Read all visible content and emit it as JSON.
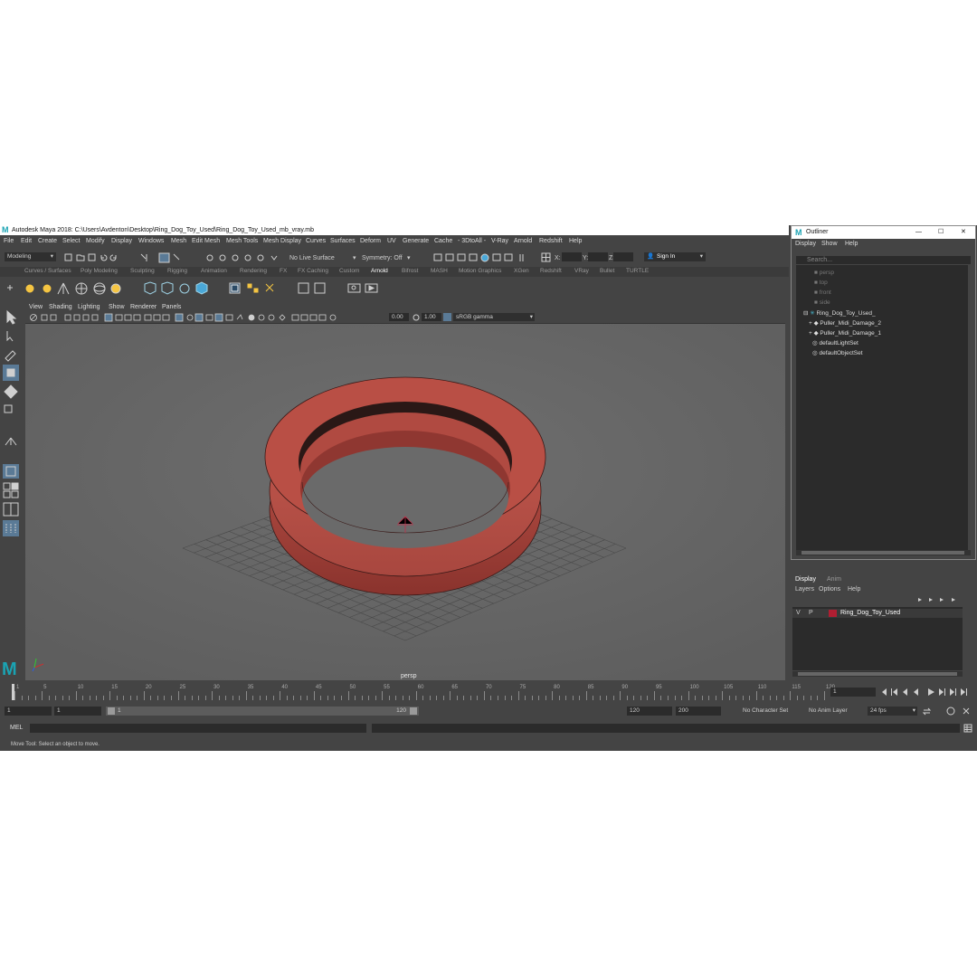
{
  "window": {
    "title": "Autodesk Maya 2018: C:\\Users\\Avdenton\\Desktop\\Ring_Dog_Toy_Used\\Ring_Dog_Toy_Used_mb_vray.mb",
    "logo": "M"
  },
  "menubar": [
    "File",
    "Edit",
    "Create",
    "Select",
    "Modify",
    "Display",
    "Windows",
    "Mesh",
    "Edit Mesh",
    "Mesh Tools",
    "Mesh Display",
    "Curves",
    "Surfaces",
    "Deform",
    "UV",
    "Generate",
    "Cache",
    "- 3DtoAll -",
    "V-Ray",
    "Arnold",
    "Redshift",
    "Help"
  ],
  "status": {
    "mode": "Modeling",
    "live_surface": "No Live Surface",
    "symmetry": "Symmetry: Off",
    "sign_in": "Sign In",
    "x_label": "X:",
    "y_label": "Y:",
    "z_label": "Z:"
  },
  "shelf_tabs": [
    "Curves / Surfaces",
    "Poly Modeling",
    "Sculpting",
    "Rigging",
    "Animation",
    "Rendering",
    "FX",
    "FX Caching",
    "Custom",
    "Arnold",
    "Bifrost",
    "MASH",
    "Motion Graphics",
    "XGen",
    "Redshift",
    "VRay",
    "Bullet",
    "TURTLE"
  ],
  "active_shelf_tab": "Arnold",
  "viewport": {
    "menus": [
      "View",
      "Shading",
      "Lighting",
      "Show",
      "Renderer",
      "Panels"
    ],
    "exposure": "0.00",
    "gamma": "1.00",
    "color_space": "sRGB gamma",
    "camera_label": "persp"
  },
  "outliner": {
    "title": "Outliner",
    "menus": [
      "Display",
      "Show",
      "Help"
    ],
    "search_placeholder": "Search...",
    "items": [
      {
        "label": "persp",
        "dim": true
      },
      {
        "label": "top",
        "dim": true
      },
      {
        "label": "front",
        "dim": true
      },
      {
        "label": "side",
        "dim": true
      },
      {
        "label": "Ring_Dog_Toy_Used_",
        "dim": false
      },
      {
        "label": "Puller_Midi_Damage_2",
        "dim": false
      },
      {
        "label": "Puller_Midi_Damage_1",
        "dim": false
      },
      {
        "label": "defaultLightSet",
        "dim": false
      },
      {
        "label": "defaultObjectSet",
        "dim": false
      }
    ]
  },
  "layers": {
    "tabs": [
      "Display",
      "Anim"
    ],
    "menus": [
      "Layers",
      "Options",
      "Help"
    ],
    "layer": {
      "v": "V",
      "p": "P",
      "name": "Ring_Dog_Toy_Used",
      "color": "#b01e32"
    }
  },
  "timeline": {
    "ticks": [
      "1",
      "5",
      "10",
      "15",
      "20",
      "25",
      "30",
      "35",
      "40",
      "45",
      "50",
      "55",
      "60",
      "65",
      "70",
      "75",
      "80",
      "85",
      "90",
      "95",
      "100",
      "105",
      "110",
      "115",
      "120"
    ],
    "current_frame": "1"
  },
  "range": {
    "start": "1",
    "start_inner": "1",
    "slider_start": "1",
    "slider_end": "120",
    "end": "120",
    "end_outer": "200",
    "character_set": "No Character Set",
    "anim_layer": "No Anim Layer",
    "fps": "24 fps"
  },
  "command": {
    "label": "MEL"
  },
  "help": {
    "text": "Move Tool: Select an object to move."
  },
  "colors": {
    "ring": "#a8473f",
    "accent": "#1aa3b3",
    "layer": "#b01e32"
  }
}
